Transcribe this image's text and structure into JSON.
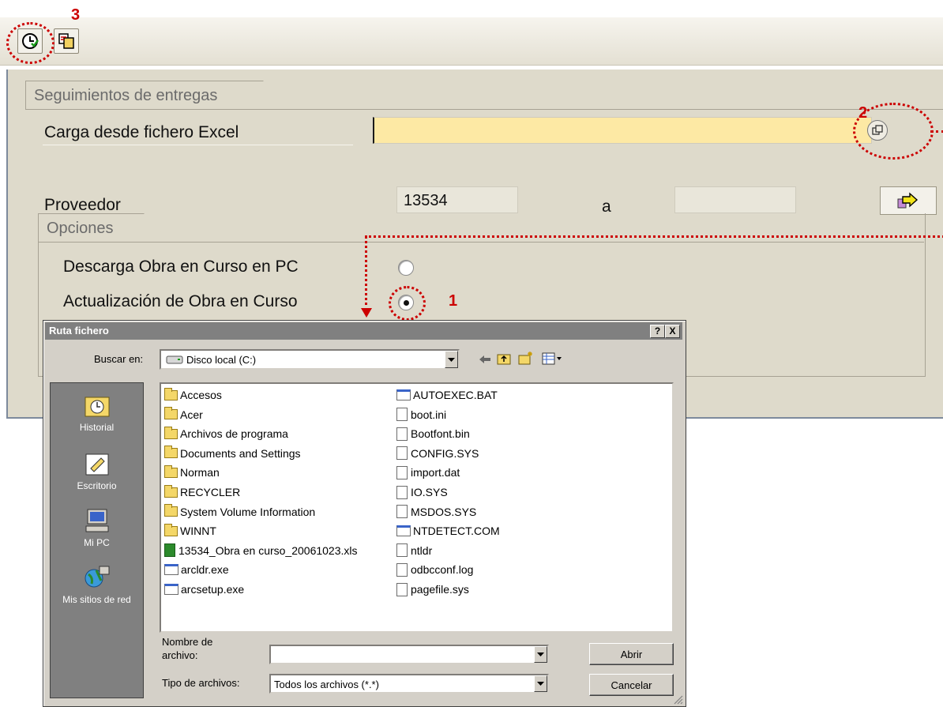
{
  "sap": {
    "toolbar": {
      "execute_icon": "clock-execute-icon",
      "variant_icon": "get-variant-icon"
    },
    "group_seguimiento": {
      "title": "Seguimientos de entregas",
      "excel_label": "Carga desde fichero Excel",
      "excel_value": "",
      "proveedor_label": "Proveedor",
      "proveedor_from": "13534",
      "proveedor_to_label": "a",
      "proveedor_to": ""
    },
    "group_opciones": {
      "title": "Opciones",
      "option_descarga": "Descarga Obra en Curso en PC",
      "option_actualizacion": "Actualización de Obra en Curso",
      "selected": "option_actualizacion"
    },
    "callouts": [
      "1",
      "2",
      "3"
    ],
    "colors": {
      "required_field": "#fde9a4",
      "callout": "#cc0000",
      "background": "#dedacb"
    }
  },
  "dialog": {
    "title": "Ruta fichero",
    "help_button": "?",
    "close_button": "X",
    "look_in_label": "Buscar en:",
    "look_in_value": "Disco local (C:)",
    "places": [
      {
        "label": "Historial",
        "icon": "history-icon"
      },
      {
        "label": "Escritorio",
        "icon": "desktop-icon"
      },
      {
        "label": "Mi PC",
        "icon": "my-computer-icon"
      },
      {
        "label": "Mis sitios de red",
        "icon": "network-places-icon"
      }
    ],
    "files_col1": [
      {
        "name": "Accesos",
        "type": "folder"
      },
      {
        "name": "Acer",
        "type": "folder"
      },
      {
        "name": "Archivos de programa",
        "type": "folder"
      },
      {
        "name": "Documents and Settings",
        "type": "folder"
      },
      {
        "name": "Norman",
        "type": "folder"
      },
      {
        "name": "RECYCLER",
        "type": "folder"
      },
      {
        "name": "System Volume Information",
        "type": "folder"
      },
      {
        "name": "WINNT",
        "type": "folder"
      },
      {
        "name": "13534_Obra en curso_20061023.xls",
        "type": "xls"
      },
      {
        "name": "arcldr.exe",
        "type": "exe"
      },
      {
        "name": "arcsetup.exe",
        "type": "exe"
      }
    ],
    "files_col2": [
      {
        "name": "AUTOEXEC.BAT",
        "type": "exe"
      },
      {
        "name": "boot.ini",
        "type": "file"
      },
      {
        "name": "Bootfont.bin",
        "type": "file"
      },
      {
        "name": "CONFIG.SYS",
        "type": "file"
      },
      {
        "name": "import.dat",
        "type": "file"
      },
      {
        "name": "IO.SYS",
        "type": "file"
      },
      {
        "name": "MSDOS.SYS",
        "type": "file"
      },
      {
        "name": "NTDETECT.COM",
        "type": "exe"
      },
      {
        "name": "ntldr",
        "type": "file"
      },
      {
        "name": "odbcconf.log",
        "type": "file"
      },
      {
        "name": "pagefile.sys",
        "type": "file"
      }
    ],
    "filename_label_1": "Nombre de",
    "filename_label_2": "archivo:",
    "filename_value": "",
    "filetype_label": "Tipo de archivos:",
    "filetype_value": "Todos los archivos (*.*)",
    "open_button": "Abrir",
    "cancel_button": "Cancelar"
  }
}
